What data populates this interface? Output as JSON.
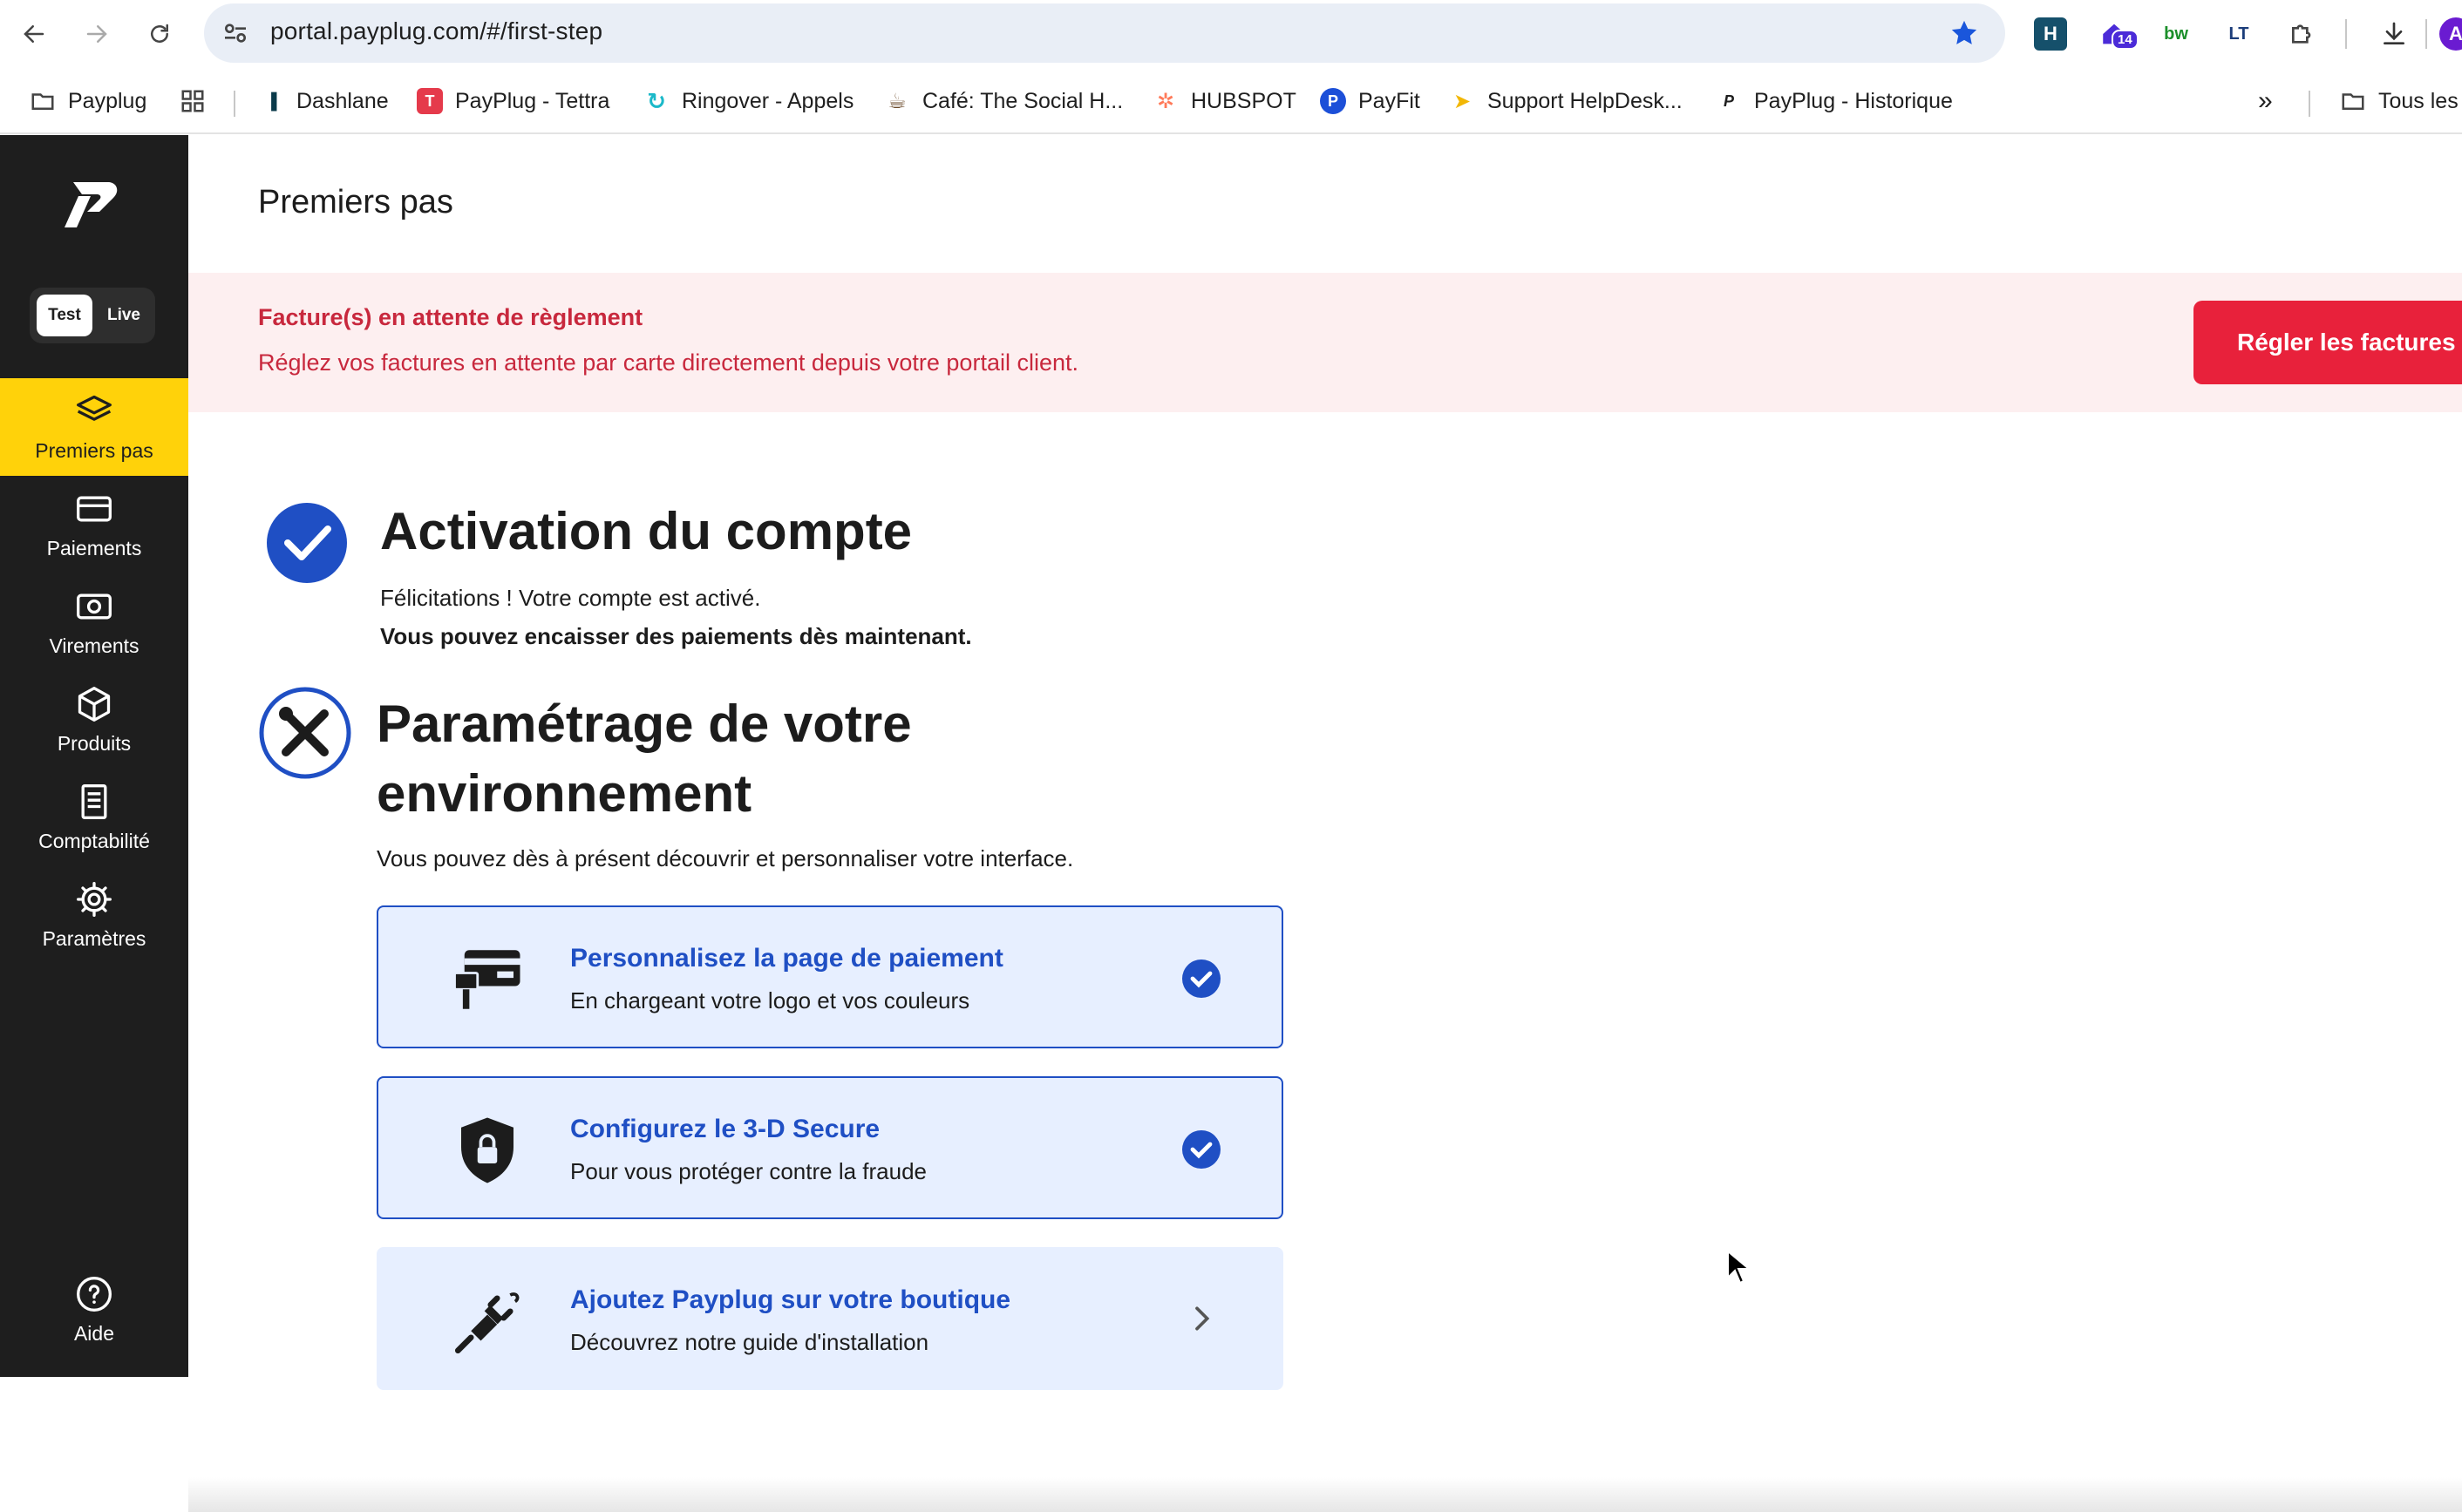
{
  "browser": {
    "url": "portal.payplug.com/#/first-step",
    "extension_badge": "14",
    "extensions": [
      "hubspot-ext",
      "bookmark-ext",
      "bw-ext",
      "lt-ext",
      "puzzle-ext"
    ],
    "bookmarks": [
      {
        "label": "Payplug",
        "icon": "folder-icon"
      },
      {
        "label": "Dashlane",
        "icon": "dashlane-icon"
      },
      {
        "label": "PayPlug - Tettra",
        "icon": "tettra-icon"
      },
      {
        "label": "Ringover - Appels",
        "icon": "ringover-icon"
      },
      {
        "label": "Café: The Social H...",
        "icon": "cafe-icon"
      },
      {
        "label": "HUBSPOT",
        "icon": "hubspot-icon"
      },
      {
        "label": "PayFit",
        "icon": "payfit-icon"
      },
      {
        "label": "Support HelpDesk...",
        "icon": "helpdesk-icon"
      },
      {
        "label": "PayPlug - Historique",
        "icon": "payplug-icon"
      }
    ],
    "overflow_label": "»",
    "all_bookmarks_label": "Tous les"
  },
  "sidebar": {
    "mode_test": "Test",
    "mode_live": "Live",
    "items": [
      {
        "label": "Premiers pas",
        "icon": "layers-icon",
        "active": true
      },
      {
        "label": "Paiements",
        "icon": "card-icon",
        "active": false
      },
      {
        "label": "Virements",
        "icon": "cash-icon",
        "active": false
      },
      {
        "label": "Produits",
        "icon": "box-icon",
        "active": false
      },
      {
        "label": "Comptabilité",
        "icon": "receipt-icon",
        "active": false
      },
      {
        "label": "Paramètres",
        "icon": "gear-icon",
        "active": false
      }
    ],
    "help": {
      "label": "Aide",
      "icon": "help-icon"
    }
  },
  "main": {
    "page_title": "Premiers pas",
    "alert": {
      "title": "Facture(s) en attente de règlement",
      "text": "Réglez vos factures en attente par carte directement depuis votre portail client.",
      "button": "Régler les factures"
    },
    "activation": {
      "title": "Activation du compte",
      "text": "Félicitations ! Votre compte est activé.",
      "strong": "Vous pouvez encaisser des paiements dès maintenant."
    },
    "setup": {
      "title": "Paramétrage de votre environnement",
      "text": "Vous pouvez dès à présent découvrir et personnaliser votre interface.",
      "cards": [
        {
          "title": "Personnalisez la page de paiement",
          "subtitle": "En chargeant votre logo et vos couleurs",
          "status": "done"
        },
        {
          "title": "Configurez le 3-D Secure",
          "subtitle": "Pour vous protéger contre la fraude",
          "status": "done"
        },
        {
          "title": "Ajoutez Payplug sur votre boutique",
          "subtitle": "Découvrez notre guide d'installation",
          "status": "todo"
        }
      ]
    }
  },
  "colors": {
    "sidebar_bg": "#1e1e1e",
    "active_yellow": "#ffd20a",
    "brand_blue": "#1f4fc4",
    "alert_red": "#e8213b",
    "alert_bg": "#fdeff0"
  }
}
